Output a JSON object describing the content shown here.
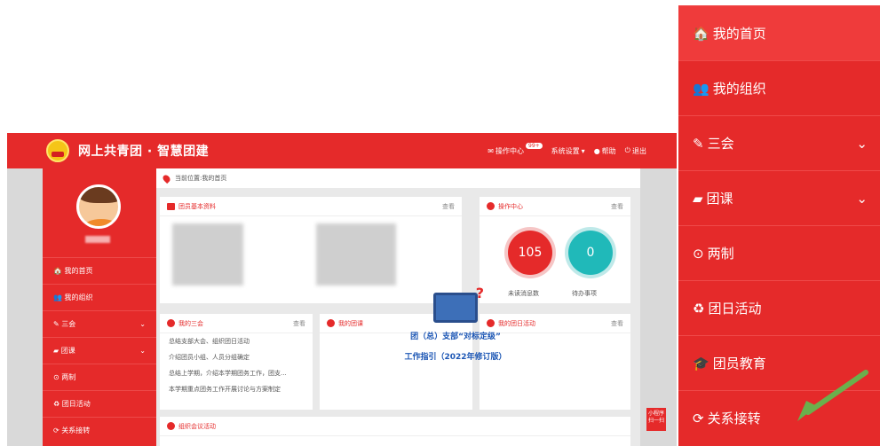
{
  "header": {
    "brand": "网上共青团 · 智慧团建",
    "nav": {
      "ops": "操作中心",
      "badge": "99+",
      "settings": "系统设置",
      "help": "帮助",
      "logout": "退出"
    }
  },
  "sidebar_small": {
    "items": [
      {
        "label": "我的首页"
      },
      {
        "label": "我的组织"
      },
      {
        "label": "三会"
      },
      {
        "label": "团课"
      },
      {
        "label": "两制"
      },
      {
        "label": "团日活动"
      },
      {
        "label": "关系接转"
      }
    ]
  },
  "breadcrumb": "当前位置:我的首页",
  "cards": {
    "profile": {
      "title": "团员基本资料",
      "more": "查看"
    },
    "ops": {
      "title": "操作中心",
      "more": "查看",
      "unread_value": "105",
      "todo_value": "0",
      "unread_label": "未读消息数",
      "todo_label": "待办事项"
    },
    "sanhui": {
      "title": "我的三会",
      "more": "查看",
      "lines": [
        "总结支部大会、组织团日活动",
        "介绍团员小组、人员分组确定",
        "总结上学期，介绍本学期团务工作，团支...",
        "本学期重点团务工作开展讨论与方案制定"
      ]
    },
    "tuanke": {
      "title": "我的团课"
    },
    "tuanri": {
      "title": "我的团日活动",
      "more": "查看"
    },
    "meeting": {
      "title": "组织会议活动"
    }
  },
  "promo": {
    "line1": "团（总）支部“对标定级”",
    "line2": "工作指引（2022年修订版）"
  },
  "miniprogram": {
    "line1": "小程序",
    "line2": "扫一扫"
  },
  "big_menu": {
    "items": [
      {
        "label": "我的首页",
        "icon": "home-icon"
      },
      {
        "label": "我的组织",
        "icon": "users-icon"
      },
      {
        "label": "三会",
        "icon": "edit-icon"
      },
      {
        "label": "团课",
        "icon": "folder-icon"
      },
      {
        "label": "两制",
        "icon": "circle-icon"
      },
      {
        "label": "团日活动",
        "icon": "recycle-icon"
      },
      {
        "label": "团员教育",
        "icon": "graduation-cap-icon"
      },
      {
        "label": "关系接转",
        "icon": "refresh-icon"
      }
    ]
  },
  "colors": {
    "primary": "#e52a2a",
    "teal": "#20b9b9",
    "promo_blue": "#1d57b5",
    "arrow": "#6ab04c"
  }
}
